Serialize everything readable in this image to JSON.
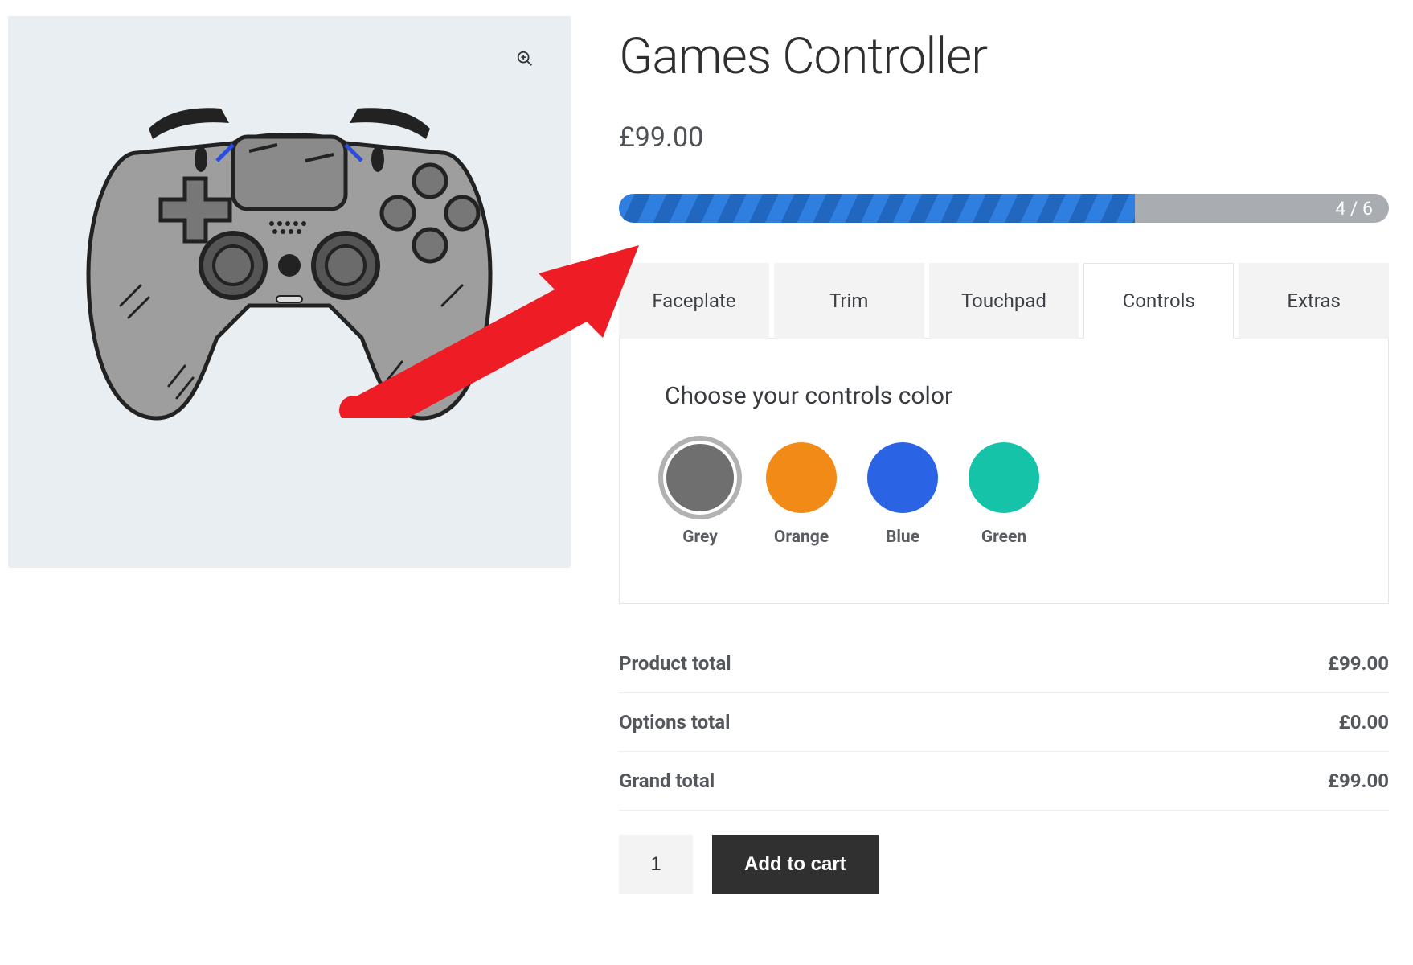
{
  "product": {
    "title": "Games Controller",
    "price": "£99.00"
  },
  "progress": {
    "label": "4 / 6",
    "current": 4,
    "total": 6
  },
  "tabs": [
    {
      "label": "Faceplate",
      "active": false
    },
    {
      "label": "Trim",
      "active": false
    },
    {
      "label": "Touchpad",
      "active": false
    },
    {
      "label": "Controls",
      "active": true
    },
    {
      "label": "Extras",
      "active": false
    }
  ],
  "tab_content": {
    "heading": "Choose your controls color",
    "swatches": [
      {
        "label": "Grey",
        "color": "#6f6f6f",
        "selected": true
      },
      {
        "label": "Orange",
        "color": "#f28a17",
        "selected": false
      },
      {
        "label": "Blue",
        "color": "#2a63e3",
        "selected": false
      },
      {
        "label": "Green",
        "color": "#14c3a8",
        "selected": false
      }
    ]
  },
  "totals": {
    "product_label": "Product total",
    "product_value": "£99.00",
    "options_label": "Options total",
    "options_value": "£0.00",
    "grand_label": "Grand total",
    "grand_value": "£99.00"
  },
  "cart": {
    "quantity": "1",
    "add_label": "Add to cart"
  },
  "icons": {
    "zoom": "magnifier-plus-icon"
  },
  "annotation_arrow": {
    "color": "#ee1c25"
  }
}
